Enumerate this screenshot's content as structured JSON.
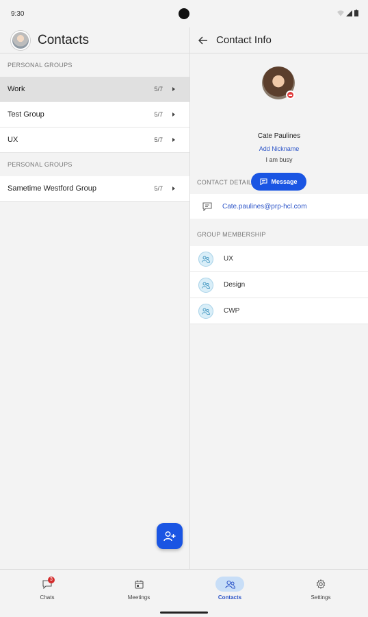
{
  "status_bar": {
    "time": "9:30"
  },
  "contacts_pane": {
    "title": "Contacts",
    "sections": [
      {
        "label": "PERSONAL GROUPS",
        "groups": [
          {
            "name": "Work",
            "count": "5/7",
            "selected": true
          },
          {
            "name": "Test Group",
            "count": "5/7",
            "selected": false
          },
          {
            "name": "UX",
            "count": "5/7",
            "selected": false
          }
        ]
      },
      {
        "label": "PERSONAL GROUPS",
        "groups": [
          {
            "name": "Sametime Westford Group",
            "count": "5/7",
            "selected": false
          }
        ]
      }
    ],
    "fab_icon": "add-person-icon"
  },
  "contact_info": {
    "title": "Contact Info",
    "name": "Cate Paulines",
    "add_nickname": "Add Nickname",
    "status": "I am busy",
    "message_button": "Message",
    "contact_details_label": "CONTACT DETAILS",
    "email": "Cate.paulines@prp-hcl.com",
    "group_membership_label": "GROUP MEMBERSHIP",
    "groups": [
      "UX",
      "Design",
      "CWP"
    ]
  },
  "bottom_nav": {
    "items": [
      {
        "label": "Chats",
        "icon": "chat-icon",
        "badge": "3"
      },
      {
        "label": "Meetings",
        "icon": "calendar-icon"
      },
      {
        "label": "Contacts",
        "icon": "contacts-icon",
        "active": true
      },
      {
        "label": "Settings",
        "icon": "gear-icon"
      }
    ]
  },
  "colors": {
    "accent": "#1a55e3",
    "link": "#2d55c8",
    "busy": "#e03c3c",
    "active_pill": "#c8def7"
  }
}
